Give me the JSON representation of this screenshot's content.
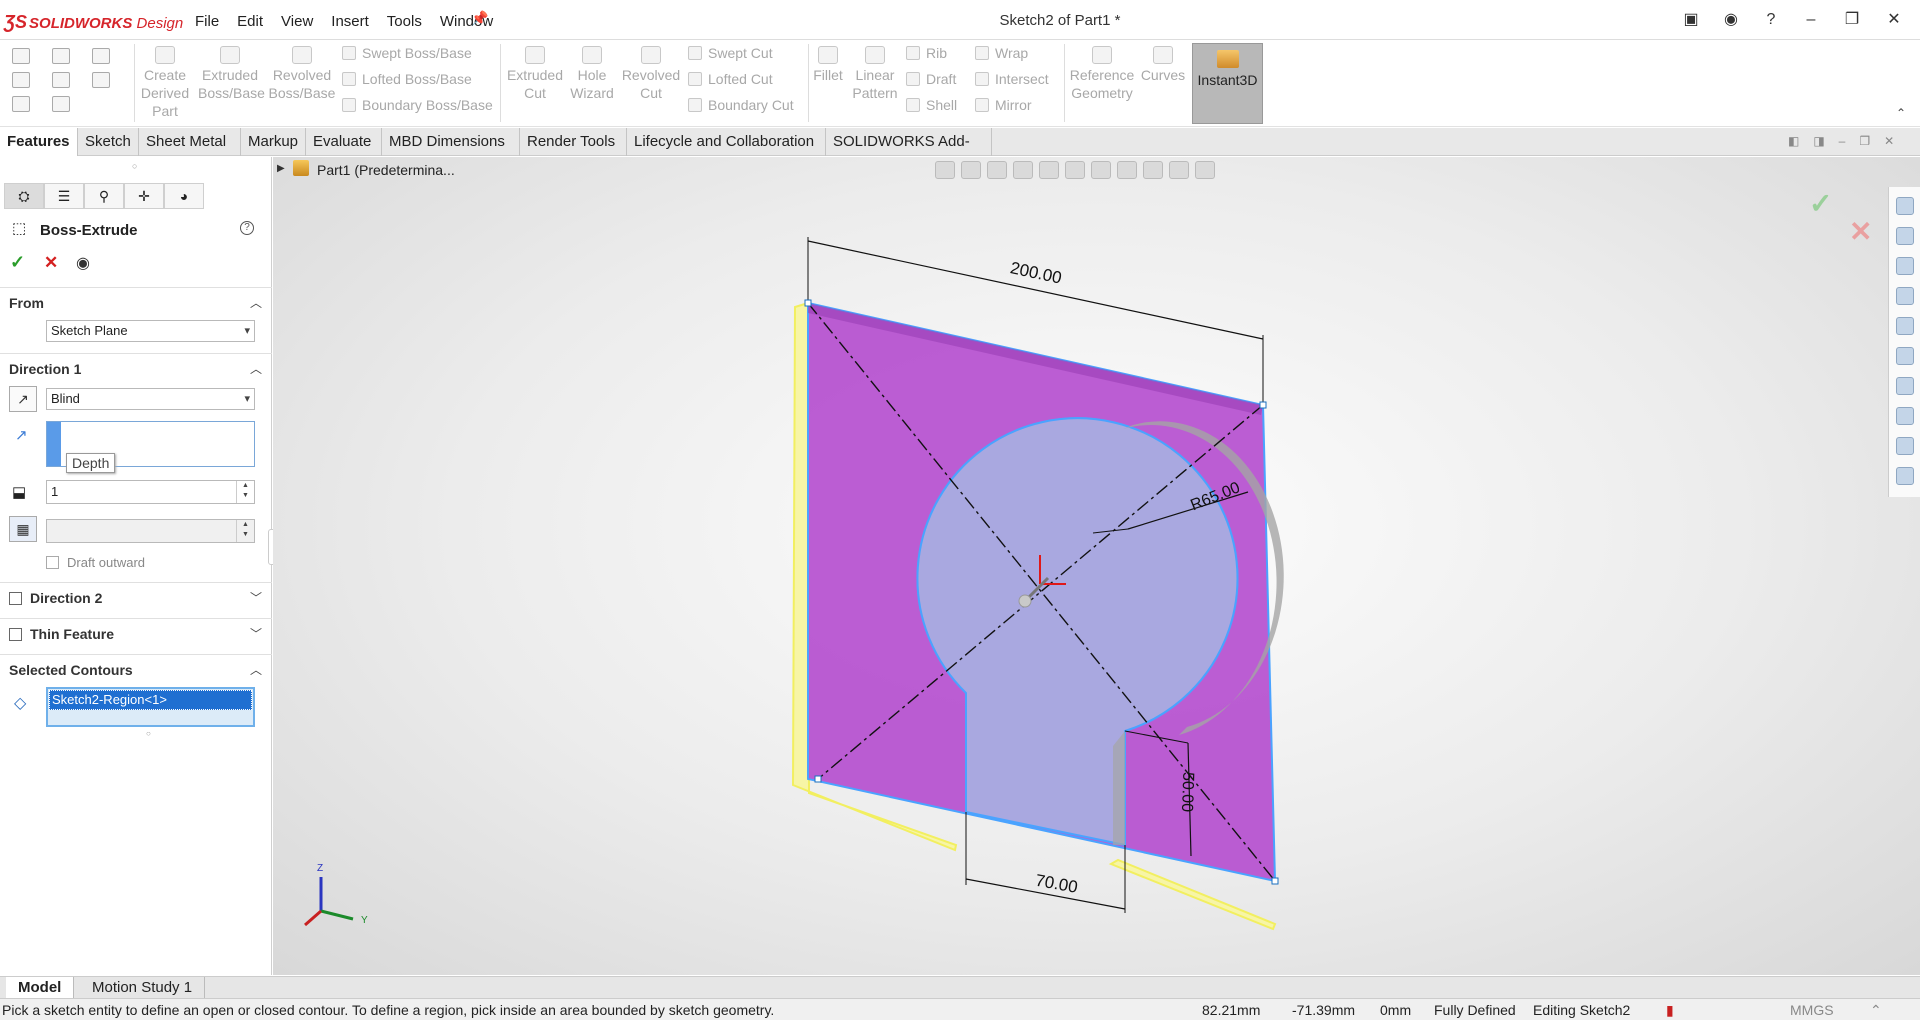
{
  "app": {
    "brand": "SOLIDWORKS",
    "brand_suffix": "Design",
    "title": "Sketch2 of Part1 *"
  },
  "menu": [
    "File",
    "Edit",
    "View",
    "Insert",
    "Tools",
    "Window"
  ],
  "toolbar": {
    "create_derived": "Create Derived Part",
    "extruded_boss": "Extruded Boss/Base",
    "revolved_boss": "Revolved Boss/Base",
    "swept_boss": "Swept Boss/Base",
    "lofted_boss": "Lofted Boss/Base",
    "boundary_boss": "Boundary Boss/Base",
    "extruded_cut": "Extruded Cut",
    "hole_wizard": "Hole Wizard",
    "revolved_cut": "Revolved Cut",
    "swept_cut": "Swept Cut",
    "lofted_cut": "Lofted Cut",
    "boundary_cut": "Boundary Cut",
    "fillet": "Fillet",
    "linear_pattern": "Linear Pattern",
    "rib": "Rib",
    "draft": "Draft",
    "shell": "Shell",
    "wrap": "Wrap",
    "intersect": "Intersect",
    "mirror": "Mirror",
    "reference_geometry": "Reference Geometry",
    "curves": "Curves",
    "instant3d": "Instant3D"
  },
  "tabs": [
    "Features",
    "Sketch",
    "Sheet Metal",
    "Markup",
    "Evaluate",
    "MBD Dimensions",
    "Render Tools",
    "Lifecycle and Collaboration",
    "SOLIDWORKS Add-Ins"
  ],
  "panel": {
    "title": "Boss-Extrude",
    "from_label": "From",
    "from_value": "Sketch Plane",
    "dir1_label": "Direction 1",
    "dir1_type": "Blind",
    "depth_tooltip": "Depth",
    "depth_value": "1",
    "draft_outward": "Draft outward",
    "dir2_label": "Direction 2",
    "thin_label": "Thin Feature",
    "contours_label": "Selected Contours",
    "contour_item": "Sketch2-Region<1>"
  },
  "viewport": {
    "tree_label": "Part1 (Predetermina...",
    "dim_width": "200.00",
    "dim_radius": "R65.00",
    "dim_height": "50.00",
    "dim_slot": "70.00",
    "axis_z": "Z",
    "axis_y": "Y",
    "accent_color": "#b54fcf",
    "selection_color": "#4aa3ff"
  },
  "bottom_tabs": [
    "Model",
    "Motion Study 1"
  ],
  "status": {
    "message": "Pick a sketch entity to define an open or closed contour. To define a region, pick inside an area bounded by sketch geometry.",
    "x": "82.21mm",
    "y": "-71.39mm",
    "z": "0mm",
    "state": "Fully Defined",
    "editing": "Editing Sketch2",
    "units": "MMGS"
  }
}
